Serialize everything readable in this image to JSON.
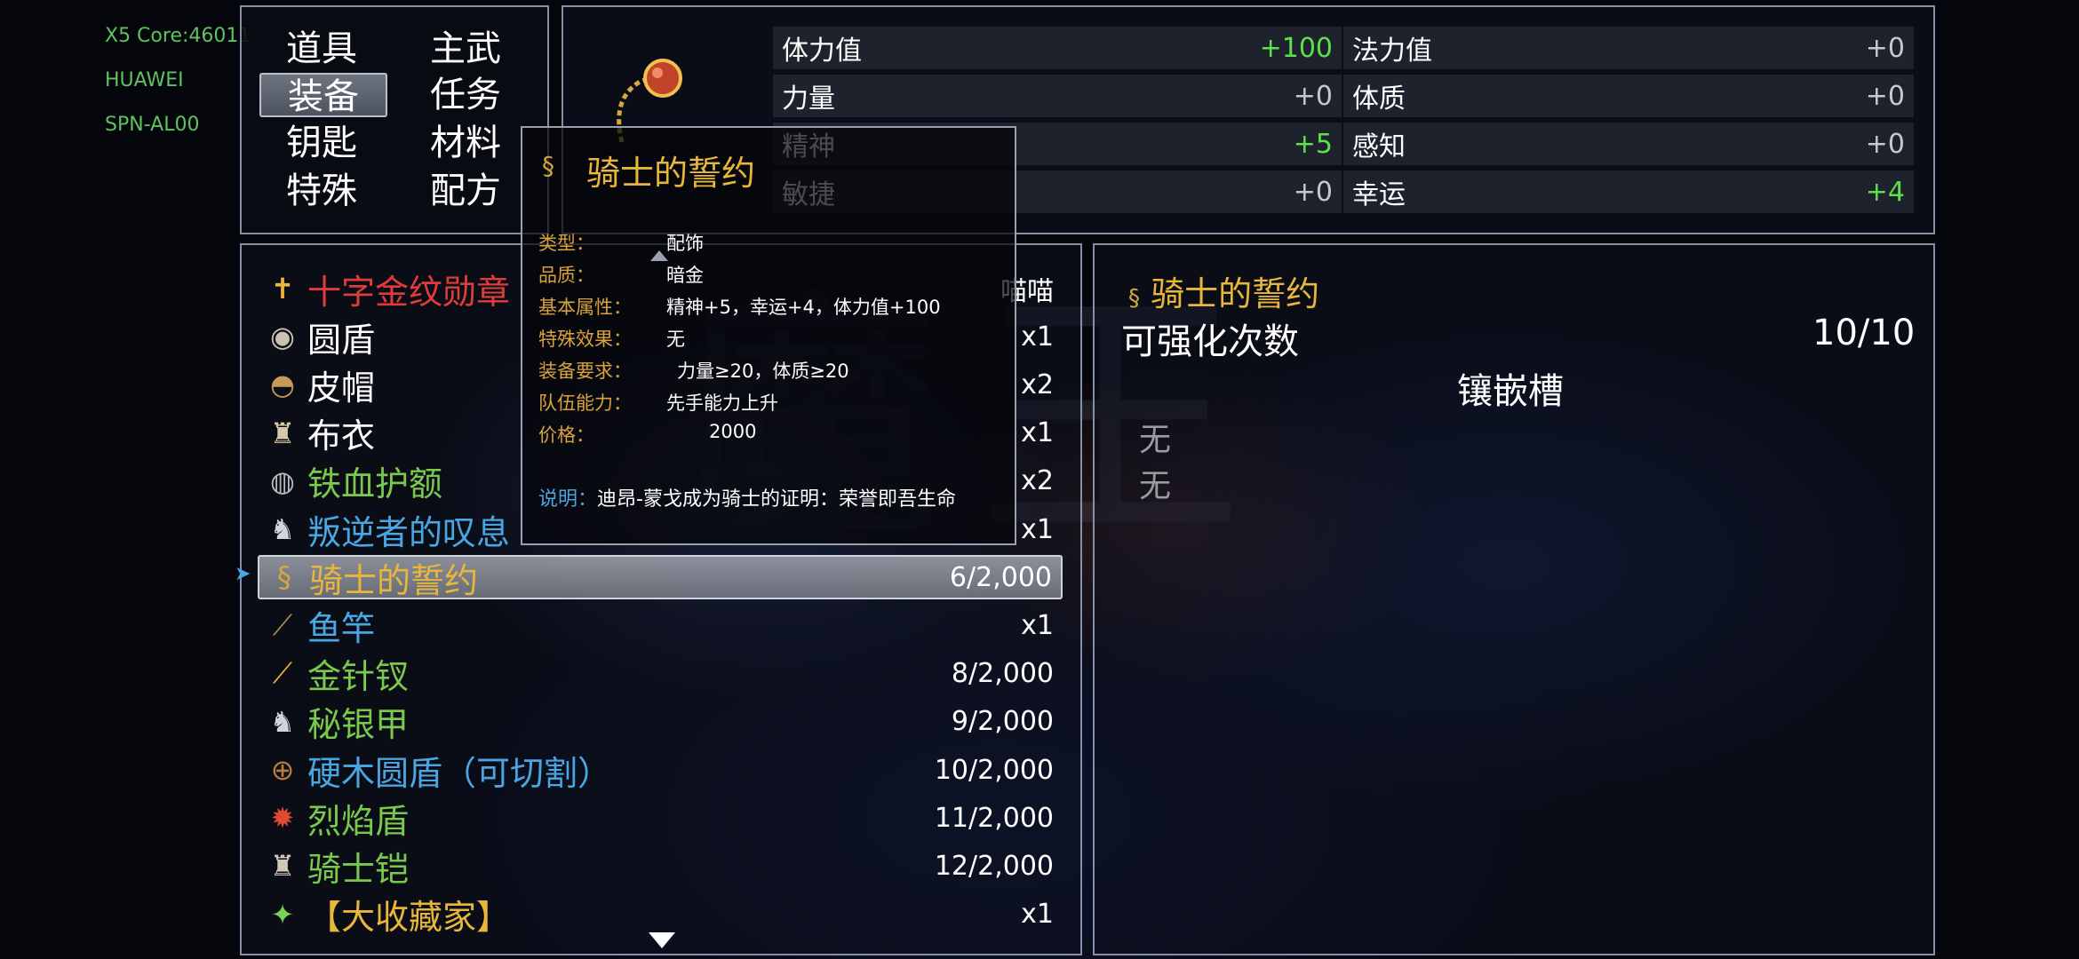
{
  "debug": {
    "line1": "X5 Core:46011",
    "line2": "HUAWEI",
    "line3": "SPN-AL00"
  },
  "categories": [
    {
      "label": "道具",
      "selected": false
    },
    {
      "label": "主武",
      "selected": false
    },
    {
      "label": "装备",
      "selected": true
    },
    {
      "label": "任务",
      "selected": false
    },
    {
      "label": "钥匙",
      "selected": false
    },
    {
      "label": "材料",
      "selected": false
    },
    {
      "label": "特殊",
      "selected": false
    },
    {
      "label": "配方",
      "selected": false
    }
  ],
  "stats": [
    {
      "label": "体力值",
      "value": "+100"
    },
    {
      "label": "法力值",
      "value": "+0"
    },
    {
      "label": "力量",
      "value": "+0"
    },
    {
      "label": "体质",
      "value": "+0"
    },
    {
      "label": "精神",
      "value": "+5"
    },
    {
      "label": "感知",
      "value": "+0"
    },
    {
      "label": "敏捷",
      "value": "+0"
    },
    {
      "label": "幸运",
      "value": "+4"
    }
  ],
  "items": [
    {
      "name": "十字金纹勋章",
      "qty": "喵喵",
      "color": "#e03c3c",
      "icon": "cross-medal-icon"
    },
    {
      "name": "圆盾",
      "qty": "x1",
      "color": "#ffffff",
      "icon": "round-shield-icon"
    },
    {
      "name": "皮帽",
      "qty": "x2",
      "color": "#ffffff",
      "icon": "leather-hat-icon"
    },
    {
      "name": "布衣",
      "qty": "x1",
      "color": "#ffffff",
      "icon": "cloth-armor-icon"
    },
    {
      "name": "铁血护额",
      "qty": "x2",
      "color": "#79c94c",
      "icon": "headband-icon"
    },
    {
      "name": "叛逆者的叹息",
      "qty": "x1",
      "color": "#4aa6e0",
      "icon": "armor-icon"
    },
    {
      "name": "骑士的誓约",
      "qty": "6/2,000",
      "color": "#e8b63a",
      "icon": "amulet-icon",
      "selected": true
    },
    {
      "name": "鱼竿",
      "qty": "x1",
      "color": "#4aa6e0",
      "icon": "fishing-rod-icon"
    },
    {
      "name": "金针钗",
      "qty": "8/2,000",
      "color": "#79c94c",
      "icon": "gold-needle-icon"
    },
    {
      "name": "秘银甲",
      "qty": "9/2,000",
      "color": "#79c94c",
      "icon": "mithril-armor-icon"
    },
    {
      "name": "硬木圆盾（可切割）",
      "qty": "10/2,000",
      "color": "#4aa6e0",
      "icon": "wooden-shield-icon"
    },
    {
      "name": "烈焰盾",
      "qty": "11/2,000",
      "color": "#79c94c",
      "icon": "flame-shield-icon"
    },
    {
      "name": "骑士铠",
      "qty": "12/2,000",
      "color": "#79c94c",
      "icon": "knight-armor-icon"
    },
    {
      "name": "【大收藏家】",
      "qty": "x1",
      "color": "#e8b63a",
      "icon": "collector-badge-icon"
    }
  ],
  "tooltip": {
    "title": "骑士的誓约",
    "rows": [
      {
        "key": "类型：",
        "value": "配饰"
      },
      {
        "key": "品质：",
        "value": "暗金"
      },
      {
        "key": "基本属性：",
        "value": "精神+5，幸运+4，体力值+100"
      },
      {
        "key": "特殊效果：",
        "value": "无"
      },
      {
        "key": "装备要求：",
        "value": "力量≥20，体质≥20"
      },
      {
        "key": "队伍能力：",
        "value": "先手能力上升"
      },
      {
        "key": "价格：",
        "value": "2000"
      }
    ],
    "desc_key": "说明：",
    "desc_value": "迪昂-蒙戈成为骑士的证明：荣誉即吾生命"
  },
  "detail": {
    "title": "骑士的誓约",
    "enhance_label": "可强化次数",
    "enhance_value": "10/10",
    "socket_label": "镶嵌槽",
    "sockets": [
      "无",
      "无"
    ]
  },
  "colors": {
    "gold": "#e8b63a",
    "green": "#79c94c",
    "blue": "#4aa6e0",
    "red": "#e03c3c"
  }
}
